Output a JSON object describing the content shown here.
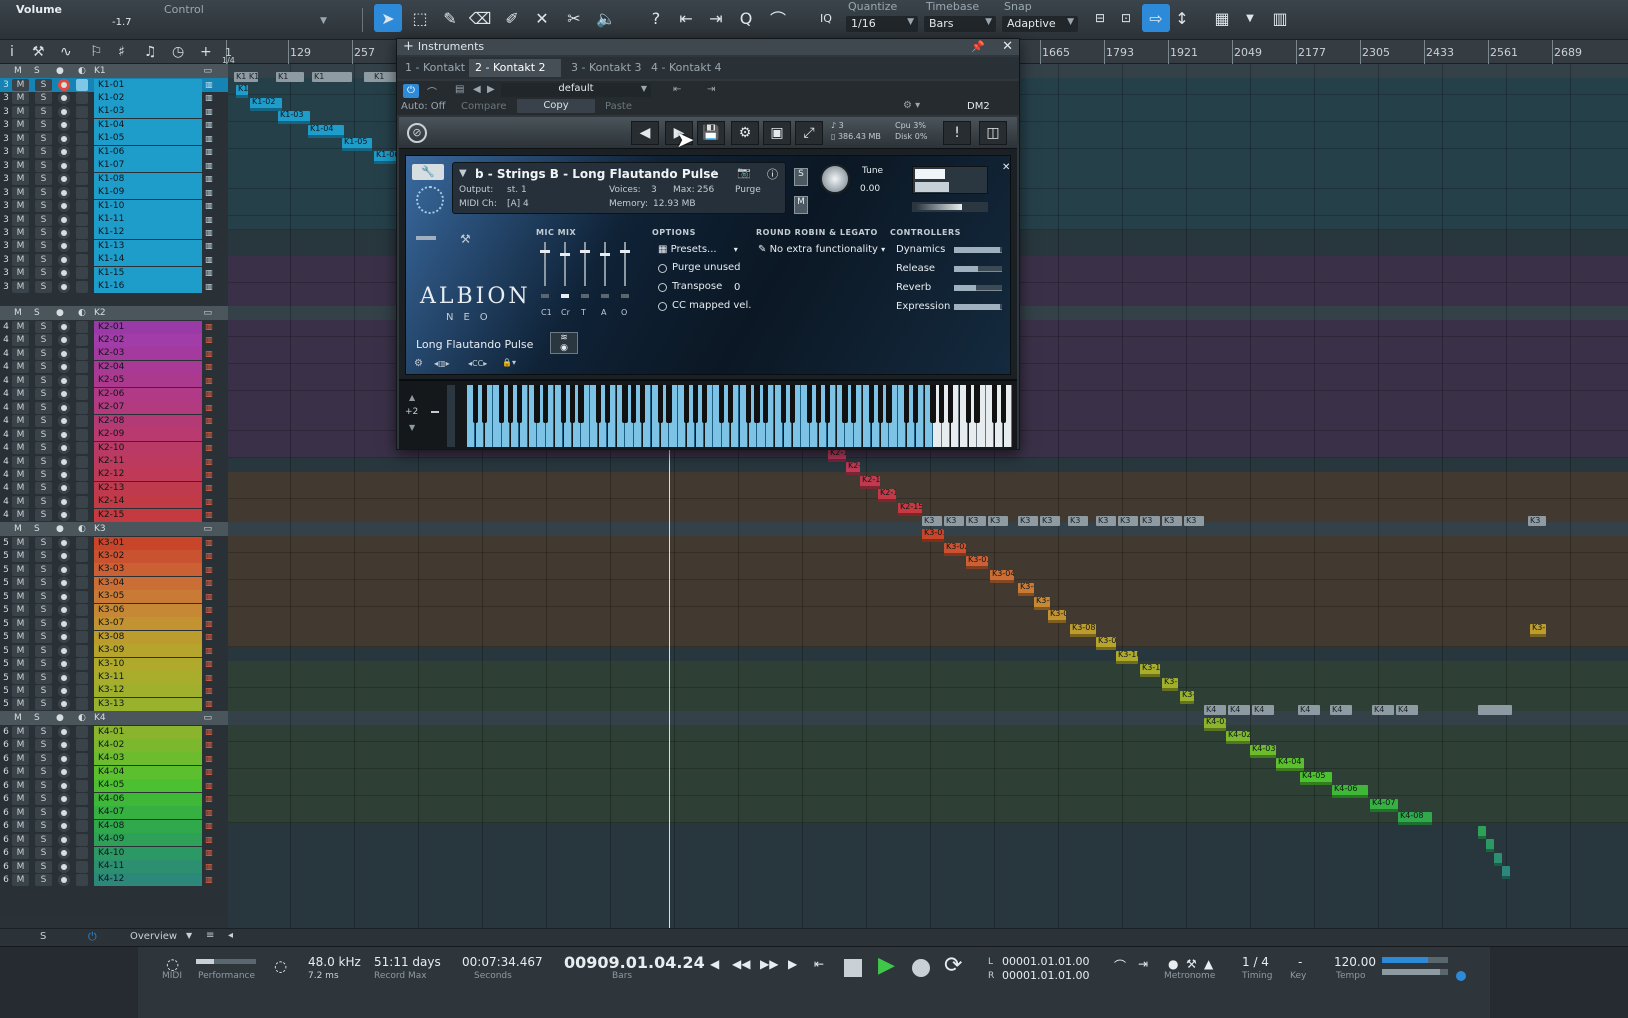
{
  "toolbar": {
    "volume_label": "Volume",
    "volume_value": "-1.7",
    "control_label": "Control",
    "quantize_label": "Quantize",
    "quantize_value": "1/16",
    "timebase_label": "Timebase",
    "timebase_value": "Bars",
    "snap_label": "Snap",
    "snap_value": "Adaptive",
    "iq_label": "IQ",
    "tools": [
      "arrow-tool-icon",
      "range-tool-icon",
      "pencil-tool-icon",
      "eraser-tool-icon",
      "paint-tool-icon",
      "mute-tool-icon",
      "split-tool-icon",
      "listen-tool-icon"
    ],
    "accent_color": "#2c8ad8"
  },
  "ruler": {
    "ticks": [
      "1",
      "129",
      "257",
      "1665",
      "1793",
      "1921",
      "2049",
      "2177",
      "2305",
      "2433",
      "2561",
      "2689"
    ],
    "first_sub": "1/4"
  },
  "folders": [
    {
      "name": "K1",
      "color": "#1aa3d2"
    },
    {
      "name": "K2",
      "color": "#c235a6"
    },
    {
      "name": "K3",
      "color": "#c8462a"
    },
    {
      "name": "K4",
      "color": "#3bbf3a"
    }
  ],
  "track_buttons": {
    "mute": "M",
    "solo": "S"
  },
  "tracks_k1": {
    "num": "3",
    "names": [
      "K1-01",
      "K1-02",
      "K1-03",
      "K1-04",
      "K1-05",
      "K1-06",
      "K1-07",
      "K1-08",
      "K1-09",
      "K1-10",
      "K1-11",
      "K1-12",
      "K1-13",
      "K1-14",
      "K1-15",
      "K1-16"
    ]
  },
  "tracks_k2": {
    "num": "4",
    "names": [
      "K2-01",
      "K2-02",
      "K2-03",
      "K2-04",
      "K2-05",
      "K2-06",
      "K2-07",
      "K2-08",
      "K2-09",
      "K2-10",
      "K2-11",
      "K2-12",
      "K2-13",
      "K2-14",
      "K2-15"
    ]
  },
  "tracks_k3": {
    "num": "5",
    "names": [
      "K3-01",
      "K3-02",
      "K3-03",
      "K3-04",
      "K3-05",
      "K3-06",
      "K3-07",
      "K3-08",
      "K3-09",
      "K3-10",
      "K3-11",
      "K3-12",
      "K3-13"
    ]
  },
  "tracks_k4": {
    "num": "6",
    "names": [
      "K4-01",
      "K4-02",
      "K4-03",
      "K4-04",
      "K4-05",
      "K4-06",
      "K4-07",
      "K4-08",
      "K4-09",
      "K4-10",
      "K4-11",
      "K4-12"
    ]
  },
  "instruments": {
    "title": "Instruments",
    "tabs": [
      "1 - Kontakt",
      "2 - Kontakt 2",
      "3 - Kontakt 3",
      "4 - Kontakt 4"
    ],
    "active_tab": "2 - Kontakt 2",
    "auto_off": "Auto: Off",
    "compare": "Compare",
    "copy": "Copy",
    "paste": "Paste",
    "preset": "default",
    "device": "DM2"
  },
  "kontakt": {
    "memory_total": "386.43 MB",
    "voices_count": "3",
    "cpu_label": "Cpu",
    "cpu_value": "3%",
    "disk_label": "Disk",
    "disk_value": "0%",
    "instrument_name": "b - Strings B - Long Flautando Pulse",
    "output_label": "Output:",
    "output_value": "st. 1",
    "voices_label": "Voices:",
    "voices_value": "3",
    "max_label": "Max:",
    "max_value": "256",
    "purge_label": "Purge",
    "midi_label": "MIDI Ch:",
    "midi_value": "[A]  4",
    "memory_label": "Memory:",
    "memory_value": "12.93 MB",
    "tune_label": "Tune",
    "tune_value": "0.00",
    "brand": "ALBION",
    "brand_sub": "NEO",
    "patch": "Long Flautando Pulse",
    "mic_mix_label": "MIC MIX",
    "mic_labels": [
      "C1",
      "Cr",
      "T",
      "A",
      "O"
    ],
    "options_label": "OPTIONS",
    "presets_label": "Presets...",
    "purge_unused": "Purge unused",
    "transpose_label": "Transpose",
    "transpose_value": "0",
    "cc_mapped": "CC mapped vel.",
    "rr_label": "ROUND ROBIN & LEGATO",
    "rr_value": "No extra functionality",
    "controllers_label": "CONTROLLERS",
    "controllers": [
      {
        "name": "Dynamics",
        "value": 0.95
      },
      {
        "name": "Release",
        "value": 0.5
      },
      {
        "name": "Reverb",
        "value": 0.45
      },
      {
        "name": "Expression",
        "value": 0.95
      }
    ],
    "octave": "+2"
  },
  "mid_bar": {
    "s_label": "S",
    "overview": "Overview"
  },
  "transport": {
    "midi_label": "MIDI",
    "performance_label": "Performance",
    "sample_rate": "48.0 kHz",
    "latency": "7.2 ms",
    "record_days": "51:11 days",
    "record_max_label": "Record Max",
    "seconds_value": "00:07:34.467",
    "seconds_label": "Seconds",
    "bars_value": "00909.01.04.24",
    "bars_label": "Bars",
    "loop_l": "00001.01.01.00",
    "loop_r": "00001.01.01.00",
    "l_label": "L",
    "r_label": "R",
    "metronome_label": "Metronome",
    "timing_value": "1 / 4",
    "timing_label": "Timing",
    "key_value": "-",
    "key_label": "Key",
    "tempo_value": "120.00",
    "tempo_label": "Tempo"
  }
}
